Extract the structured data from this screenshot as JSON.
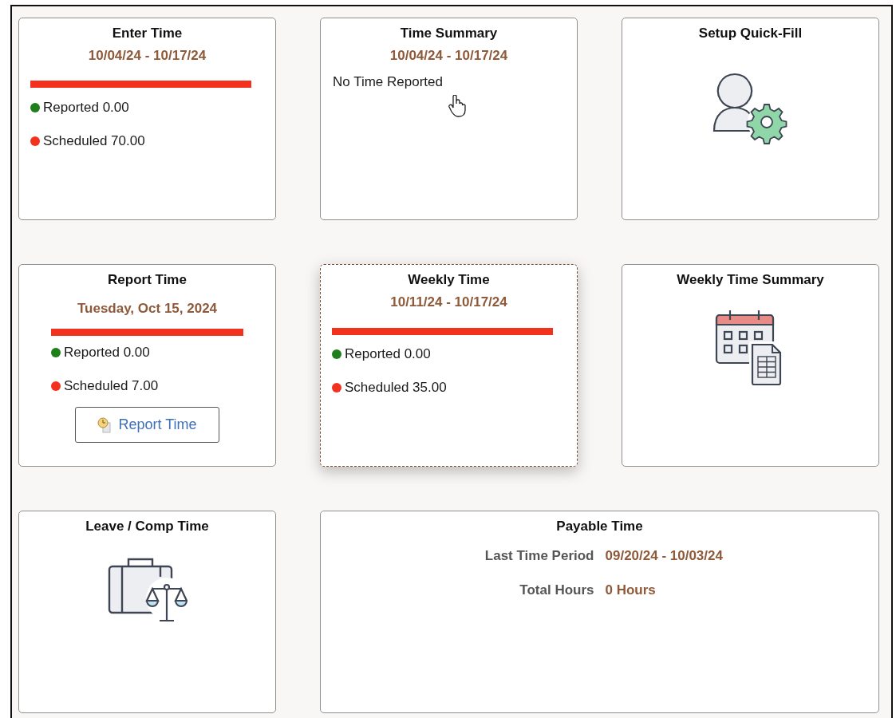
{
  "tiles": [
    {
      "kind": "progress",
      "title": "Enter Time",
      "date": "10/04/24 - 10/17/24",
      "focused": false,
      "stats": [
        {
          "label": "Reported 0.00",
          "color": "#1f7f1a"
        },
        {
          "label": "Scheduled 70.00",
          "color": "#f2321f"
        }
      ]
    },
    {
      "kind": "summary",
      "title": "Time Summary",
      "date": "10/04/24 - 10/17/24",
      "focused": false,
      "message": "No Time Reported"
    },
    {
      "kind": "setup",
      "title": "Setup Quick-Fill",
      "focused": false
    },
    {
      "kind": "report",
      "title": "Report Time",
      "date": "Tuesday, Oct 15, 2024",
      "focused": false,
      "stats": [
        {
          "label": "Reported 0.00",
          "color": "#1f7f1a"
        },
        {
          "label": "Scheduled 7.00",
          "color": "#f2321f"
        }
      ],
      "button": "Report Time"
    },
    {
      "kind": "progress",
      "title": "Weekly Time",
      "date": "10/11/24 - 10/17/24",
      "focused": true,
      "stats": [
        {
          "label": "Reported 0.00",
          "color": "#1f7f1a"
        },
        {
          "label": "Scheduled 35.00",
          "color": "#f2321f"
        }
      ]
    },
    {
      "kind": "calendar",
      "title": "Weekly Time Summary",
      "focused": false
    },
    {
      "kind": "leave",
      "title": "Leave / Comp Time",
      "focused": false
    },
    {
      "kind": "payable",
      "title": "Payable Time",
      "focused": false,
      "rows": [
        {
          "label": "Last Time Period",
          "value": "09/20/24 - 10/03/24"
        },
        {
          "label": "Total Hours",
          "value": "0 Hours"
        }
      ]
    }
  ]
}
